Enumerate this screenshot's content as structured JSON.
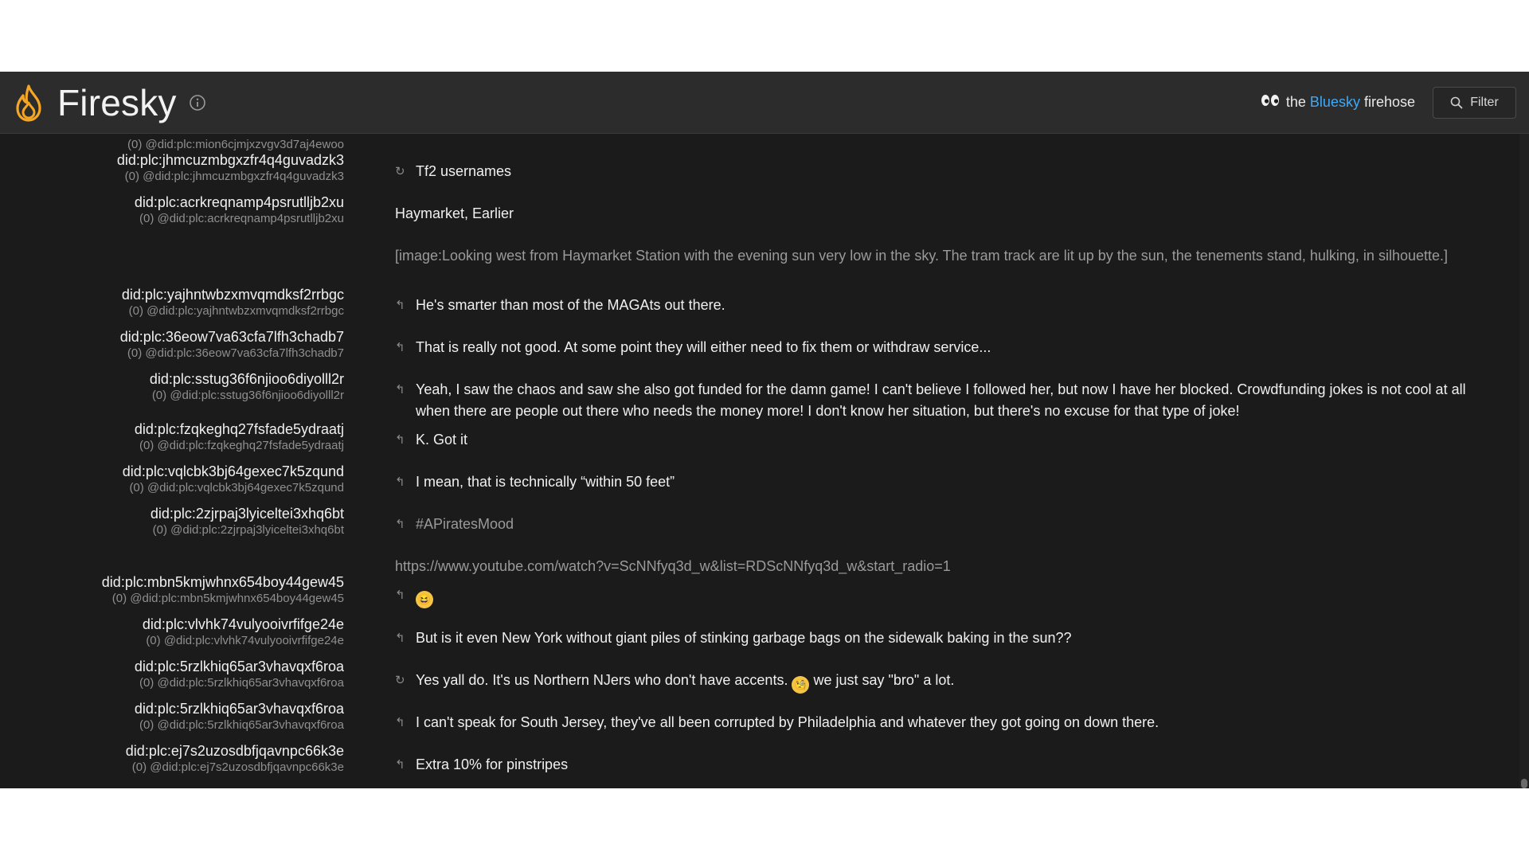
{
  "header": {
    "title": "Firesky",
    "tagline": {
      "pre": "the",
      "brand": "Bluesky",
      "post": "firehose"
    },
    "filter_label": "Filter",
    "brand_color": "#f5a623",
    "accent_color": "#3fa9f5"
  },
  "users": [
    {
      "did": "",
      "sub": "(0) @did:plc:mion6cjmjxzvgv3d7aj4ewoo"
    },
    {
      "did": "did:plc:jhmcuzmbgxzfr4q4guvadzk3",
      "sub": "(0) @did:plc:jhmcuzmbgxzfr4q4guvadzk3"
    },
    {
      "did": "did:plc:acrkreqnamp4psrutlljb2xu",
      "sub": "(0) @did:plc:acrkreqnamp4psrutlljb2xu"
    },
    {
      "did": "did:plc:yajhntwbzxmvqmdksf2rrbgc",
      "sub": "(0) @did:plc:yajhntwbzxmvqmdksf2rrbgc"
    },
    {
      "did": "did:plc:36eow7va63cfa7lfh3chadb7",
      "sub": "(0) @did:plc:36eow7va63cfa7lfh3chadb7"
    },
    {
      "did": "did:plc:sstug36f6njioo6diyolll2r",
      "sub": "(0) @did:plc:sstug36f6njioo6diyolll2r"
    },
    {
      "did": "did:plc:fzqkeghq27fsfade5ydraatj",
      "sub": "(0) @did:plc:fzqkeghq27fsfade5ydraatj"
    },
    {
      "did": "did:plc:vqlcbk3bj64gexec7k5zqund",
      "sub": "(0) @did:plc:vqlcbk3bj64gexec7k5zqund"
    },
    {
      "did": "did:plc:2zjrpaj3lyiceltei3xhq6bt",
      "sub": "(0) @did:plc:2zjrpaj3lyiceltei3xhq6bt"
    },
    {
      "did": "did:plc:mbn5kmjwhnx654boy44gew45",
      "sub": "(0) @did:plc:mbn5kmjwhnx654boy44gew45"
    },
    {
      "did": "did:plc:vlvhk74vulyooivrfifge24e",
      "sub": "(0) @did:plc:vlvhk74vulyooivrfifge24e"
    },
    {
      "did": "did:plc:5rzlkhiq65ar3vhavqxf6roa",
      "sub": "(0) @did:plc:5rzlkhiq65ar3vhavqxf6roa"
    },
    {
      "did": "did:plc:5rzlkhiq65ar3vhavqxf6roa",
      "sub": "(0) @did:plc:5rzlkhiq65ar3vhavqxf6roa"
    },
    {
      "did": "did:plc:ej7s2uzosdbfjqavnpc66k3e",
      "sub": "(0) @did:plc:ej7s2uzosdbfjqavnpc66k3e"
    }
  ],
  "posts": [
    {
      "icon": "repost-icon",
      "text": "Tf2 usernames"
    },
    {
      "icon": "",
      "text": "Haymarket, Earlier"
    },
    {
      "icon": "",
      "text": "[image:Looking west from Haymarket Station with the evening sun very low in the sky. The tram track are lit up by the sun, the tenements stand, hulking, in silhouette.]"
    },
    {
      "icon": "reply-icon",
      "text": "He's smarter than most of the MAGAts out there."
    },
    {
      "icon": "reply-icon",
      "text": "That is really not good. At some point they will either need to fix them or withdraw service..."
    },
    {
      "icon": "reply-icon",
      "text": "Yeah, I saw the chaos and saw she also got funded for the damn game! I can't believe I followed her, but now I have her blocked. Crowdfunding jokes is not cool at all when there are people out there who needs the money more! I don't know her situation, but there's no excuse for that type of joke!"
    },
    {
      "icon": "reply-icon",
      "text": "K. Got it"
    },
    {
      "icon": "reply-icon",
      "text": "I mean, that is technically “within 50 feet”"
    },
    {
      "icon": "reply-icon",
      "text": "#APiratesMood"
    },
    {
      "icon": "",
      "text": "https://www.youtube.com/watch?v=ScNNfyq3d_w&list=RDScNNfyq3d_w&start_radio=1"
    },
    {
      "icon": "reply-icon",
      "text": "😆"
    },
    {
      "icon": "reply-icon",
      "text": "But is it even New York without giant piles of stinking garbage bags on the sidewalk baking in the sun??"
    },
    {
      "icon": "repost-icon",
      "text_a": "Yes yall do. It's us Northern NJers who don't have accents.",
      "emoji": "🧐",
      "text_b": "we just say \"bro\" a lot."
    },
    {
      "icon": "reply-icon",
      "text": "I can't speak for South Jersey, they've all been corrupted by Philadelphia and whatever they got going on down there."
    },
    {
      "icon": "reply-icon",
      "text": "Extra 10% for pinstripes"
    }
  ]
}
